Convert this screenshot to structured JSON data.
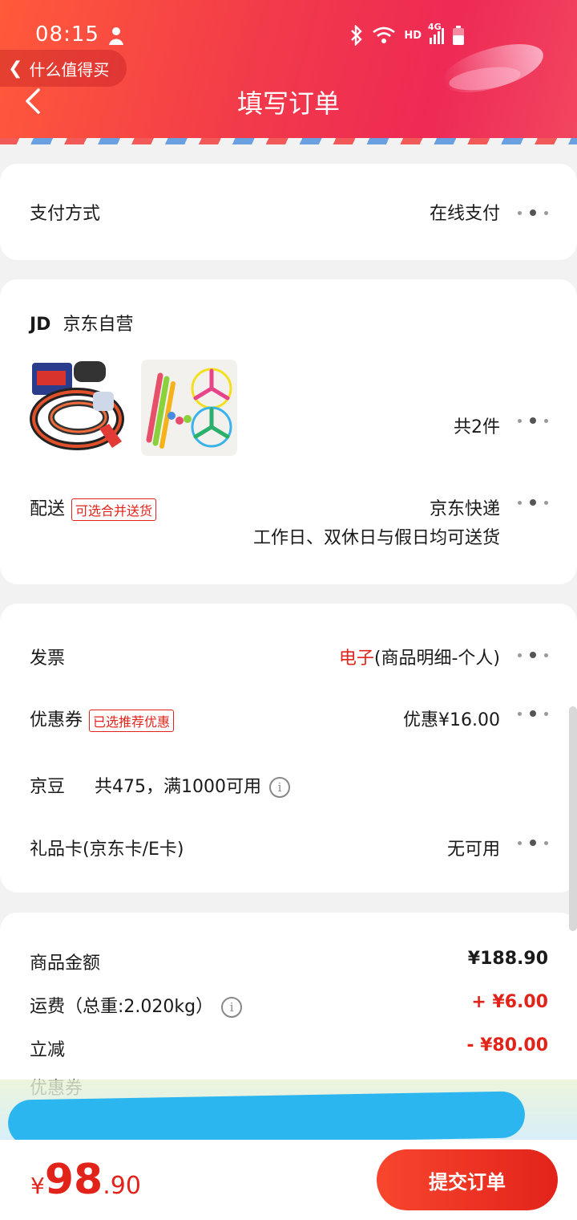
{
  "status_bar": {
    "time": "08:15",
    "network": "HD",
    "signal": "4G"
  },
  "nav": {
    "back_app_label": "什么值得买",
    "title": "填写订单"
  },
  "payment": {
    "label": "支付方式",
    "value": "在线支付"
  },
  "store": {
    "logo": "JD",
    "name": "京东自营"
  },
  "items": {
    "count_text": "共2件"
  },
  "delivery": {
    "label": "配送",
    "tag": "可选合并送货",
    "carrier": "京东快递",
    "schedule": "工作日、双休日与假日均可送货"
  },
  "invoice": {
    "label": "发票",
    "type": "电子",
    "detail": "(商品明细-个人)"
  },
  "coupon": {
    "label": "优惠券",
    "tag": "已选推荐优惠",
    "value": "优惠¥16.00"
  },
  "jingdou": {
    "label": "京豆",
    "value": "共475，满1000可用",
    "info_icon": "info-icon"
  },
  "giftcard": {
    "label": "礼品卡(京东卡/E卡)",
    "value": "无可用"
  },
  "summary": {
    "goods_label": "商品金额",
    "goods_value": "¥188.90",
    "shipping_label": "运费（总重:2.020kg）",
    "shipping_value": "+ ¥6.00",
    "discount_label": "立减",
    "discount_value": "- ¥80.00",
    "coupon_label": "优惠券"
  },
  "footer": {
    "currency": "¥",
    "total_int": "98",
    "total_dec": ".90",
    "submit_label": "提交订单"
  },
  "colors": {
    "accent": "#e2231a",
    "header_start": "#ff5a3a",
    "header_end": "#ee2a55"
  }
}
